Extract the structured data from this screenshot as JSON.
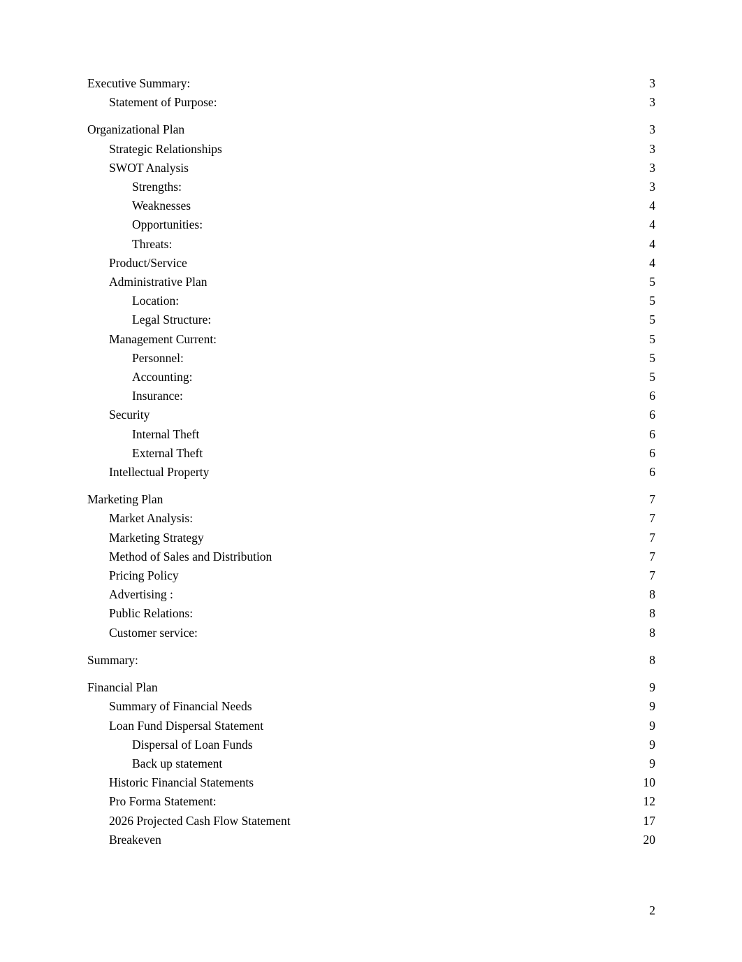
{
  "document": {
    "footer_page_number": "2",
    "text_color": "#000000",
    "background_color": "#ffffff"
  },
  "toc": {
    "entries": [
      {
        "label": "Executive Summary:",
        "page": "3",
        "level": 0,
        "gap_before": false
      },
      {
        "label": "Statement of Purpose:",
        "page": "3",
        "level": 1,
        "gap_before": false
      },
      {
        "label": "Organizational Plan",
        "page": "3",
        "level": 0,
        "gap_before": true
      },
      {
        "label": "Strategic Relationships",
        "page": "3",
        "level": 1,
        "gap_before": false
      },
      {
        "label": "SWOT Analysis",
        "page": "3",
        "level": 1,
        "gap_before": false
      },
      {
        "label": "Strengths:",
        "page": "3",
        "level": 2,
        "gap_before": false
      },
      {
        "label": "Weaknesses",
        "page": "4",
        "level": 2,
        "gap_before": false
      },
      {
        "label": "Opportunities:",
        "page": "4",
        "level": 2,
        "gap_before": false
      },
      {
        "label": "Threats:",
        "page": "4",
        "level": 2,
        "gap_before": false
      },
      {
        "label": "Product/Service",
        "page": "4",
        "level": 1,
        "gap_before": false
      },
      {
        "label": "Administrative Plan",
        "page": "5",
        "level": 1,
        "gap_before": false
      },
      {
        "label": "Location:",
        "page": "5",
        "level": 2,
        "gap_before": false
      },
      {
        "label": "Legal Structure:",
        "page": "5",
        "level": 2,
        "gap_before": false
      },
      {
        "label": "Management Current:",
        "page": "5",
        "level": 1,
        "gap_before": false
      },
      {
        "label": "Personnel:",
        "page": "5",
        "level": 2,
        "gap_before": false
      },
      {
        "label": "Accounting:",
        "page": "5",
        "level": 2,
        "gap_before": false
      },
      {
        "label": "Insurance:",
        "page": "6",
        "level": 2,
        "gap_before": false
      },
      {
        "label": "Security",
        "page": "6",
        "level": 1,
        "gap_before": false
      },
      {
        "label": "Internal Theft",
        "page": "6",
        "level": 2,
        "gap_before": false
      },
      {
        "label": "External Theft",
        "page": "6",
        "level": 2,
        "gap_before": false
      },
      {
        "label": "Intellectual Property",
        "page": "6",
        "level": 1,
        "gap_before": false
      },
      {
        "label": "Marketing Plan",
        "page": "7",
        "level": 0,
        "gap_before": true
      },
      {
        "label": "Market Analysis:",
        "page": "7",
        "level": 1,
        "gap_before": false
      },
      {
        "label": "Marketing Strategy",
        "page": "7",
        "level": 1,
        "gap_before": false
      },
      {
        "label": "Method of Sales and Distribution",
        "page": "7",
        "level": 1,
        "gap_before": false
      },
      {
        "label": "Pricing Policy",
        "page": "7",
        "level": 1,
        "gap_before": false
      },
      {
        "label": "Advertising :",
        "page": "8",
        "level": 1,
        "gap_before": false
      },
      {
        "label": "Public Relations:",
        "page": "8",
        "level": 1,
        "gap_before": false
      },
      {
        "label": "Customer service:",
        "page": "8",
        "level": 1,
        "gap_before": false
      },
      {
        "label": "Summary:",
        "page": "8",
        "level": 0,
        "gap_before": true
      },
      {
        "label": "Financial Plan",
        "page": "9",
        "level": 0,
        "gap_before": true
      },
      {
        "label": "Summary of Financial Needs",
        "page": "9",
        "level": 1,
        "gap_before": false
      },
      {
        "label": "Loan Fund Dispersal Statement",
        "page": "9",
        "level": 1,
        "gap_before": false
      },
      {
        "label": "Dispersal of Loan Funds",
        "page": "9",
        "level": 2,
        "gap_before": false
      },
      {
        "label": "Back up statement",
        "page": "9",
        "level": 2,
        "gap_before": false
      },
      {
        "label": "Historic Financial Statements",
        "page": "10",
        "level": 1,
        "gap_before": false
      },
      {
        "label": "Pro Forma Statement:",
        "page": "12",
        "level": 1,
        "gap_before": false
      },
      {
        "label": "2026 Projected Cash Flow Statement",
        "page": "17",
        "level": 1,
        "gap_before": false
      },
      {
        "label": "Breakeven",
        "page": "20",
        "level": 1,
        "gap_before": false
      }
    ]
  }
}
